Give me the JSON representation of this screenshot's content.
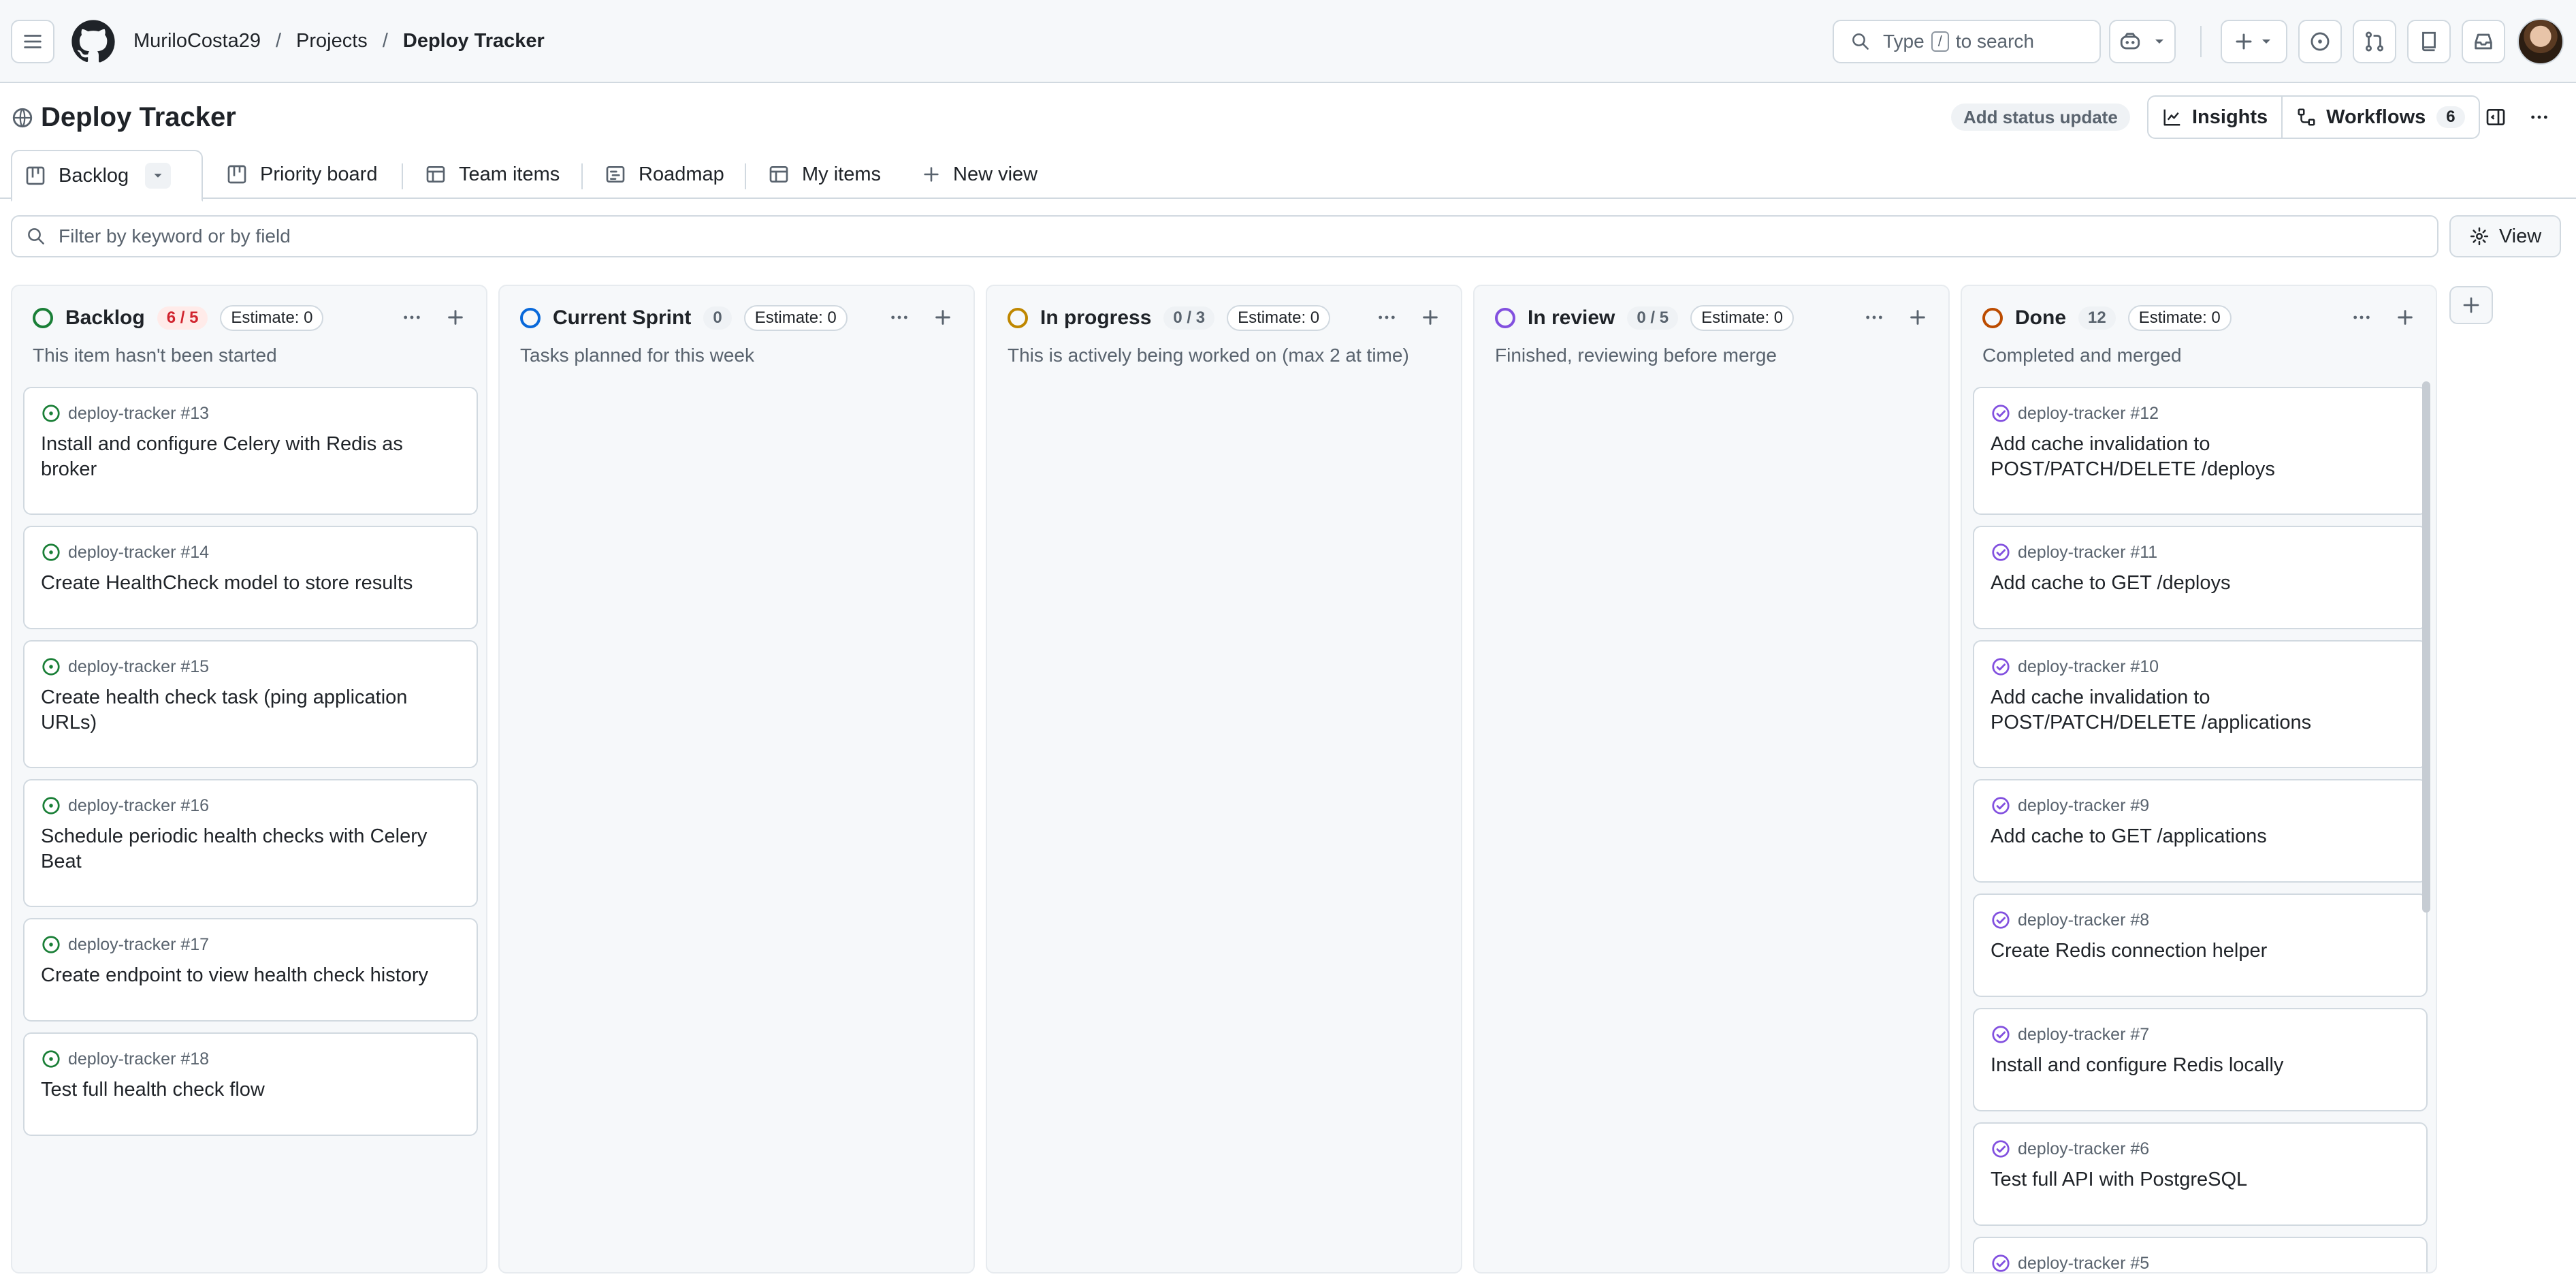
{
  "header": {
    "breadcrumb": [
      "MuriloCosta29",
      "Projects",
      "Deploy Tracker"
    ],
    "search": {
      "prefix": "Type",
      "key": "/",
      "suffix": "to search"
    }
  },
  "project": {
    "title": "Deploy Tracker",
    "status_update_label": "Add status update",
    "insights_label": "Insights",
    "workflows_label": "Workflows",
    "workflows_count": "6"
  },
  "tabs": [
    {
      "label": "Backlog",
      "icon": "board-icon",
      "active": true
    },
    {
      "label": "Priority board",
      "icon": "board-icon"
    },
    {
      "label": "Team items",
      "icon": "table-icon"
    },
    {
      "label": "Roadmap",
      "icon": "roadmap-icon"
    },
    {
      "label": "My items",
      "icon": "table-icon"
    },
    {
      "label": "New view",
      "icon": "plus-icon"
    }
  ],
  "filter": {
    "placeholder": "Filter by keyword or by field",
    "view_label": "View"
  },
  "colors": {
    "backlog": "#1a7f37",
    "sprint": "#0969da",
    "progress": "#bf8700",
    "review": "#8250df",
    "done": "#bc4c00",
    "open_issue": "#1a7f37",
    "closed_issue": "#8250df"
  },
  "columns": [
    {
      "name": "Backlog",
      "count": "6 / 5",
      "over_limit": true,
      "estimate": "Estimate: 0",
      "description": "This item hasn't been started",
      "cards": [
        {
          "ref": "deploy-tracker #13",
          "title": "Install and configure Celery with Redis as broker"
        },
        {
          "ref": "deploy-tracker #14",
          "title": "Create HealthCheck model to store results"
        },
        {
          "ref": "deploy-tracker #15",
          "title": "Create health check task (ping application URLs)"
        },
        {
          "ref": "deploy-tracker #16",
          "title": "Schedule periodic health checks with Celery Beat"
        },
        {
          "ref": "deploy-tracker #17",
          "title": "Create endpoint to view health check history"
        },
        {
          "ref": "deploy-tracker #18",
          "title": "Test full health check flow"
        }
      ]
    },
    {
      "name": "Current Sprint",
      "count": "0",
      "estimate": "Estimate: 0",
      "description": "Tasks planned for this week",
      "cards": []
    },
    {
      "name": "In progress",
      "count": "0 / 3",
      "estimate": "Estimate: 0",
      "description": "This is actively being worked on (max 2 at time)",
      "cards": []
    },
    {
      "name": "In review",
      "count": "0 / 5",
      "estimate": "Estimate: 0",
      "description": "Finished, reviewing before merge",
      "cards": []
    },
    {
      "name": "Done",
      "count": "12",
      "estimate": "Estimate: 0",
      "description": "Completed and merged",
      "cards": [
        {
          "ref": "deploy-tracker #12",
          "title": "Add cache invalidation to POST/PATCH/DELETE /deploys"
        },
        {
          "ref": "deploy-tracker #11",
          "title": "Add cache to GET /deploys"
        },
        {
          "ref": "deploy-tracker #10",
          "title": "Add cache invalidation to POST/PATCH/DELETE /applications"
        },
        {
          "ref": "deploy-tracker #9",
          "title": "Add cache to GET /applications"
        },
        {
          "ref": "deploy-tracker #8",
          "title": "Create Redis connection helper"
        },
        {
          "ref": "deploy-tracker #7",
          "title": "Install and configure Redis locally"
        },
        {
          "ref": "deploy-tracker #6",
          "title": "Test full API with PostgreSQL"
        },
        {
          "ref": "deploy-tracker #5",
          "title": ""
        }
      ]
    }
  ]
}
